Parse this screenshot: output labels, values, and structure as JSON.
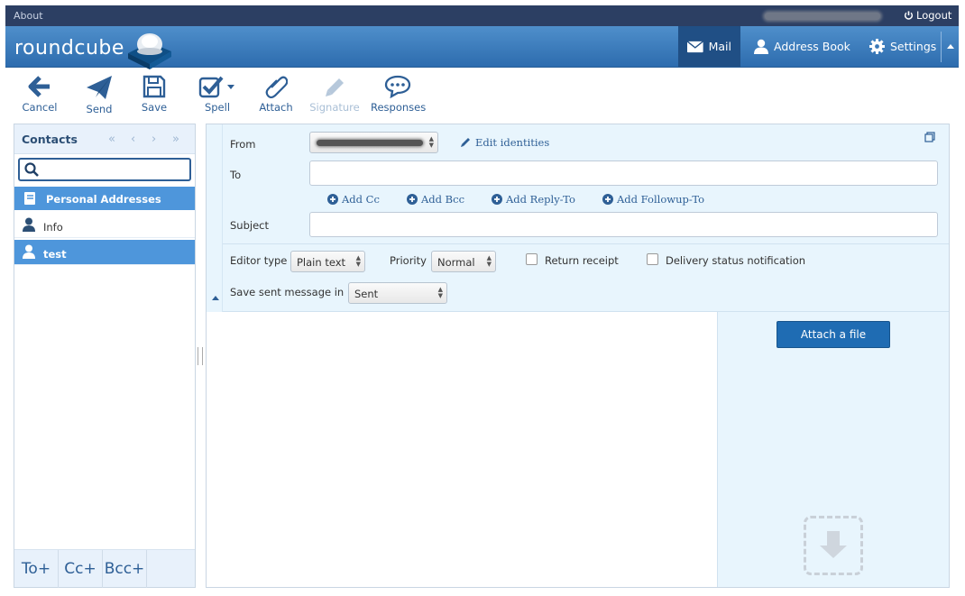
{
  "topline": {
    "about": "About",
    "logout": "Logout"
  },
  "header": {
    "logo": "roundcube",
    "tabs": [
      {
        "label": "Mail",
        "icon": "envelope-icon"
      },
      {
        "label": "Address Book",
        "icon": "person-icon"
      },
      {
        "label": "Settings",
        "icon": "gear-icon"
      }
    ]
  },
  "toolbar": {
    "cancel": "Cancel",
    "send": "Send",
    "save": "Save",
    "spell": "Spell",
    "attach": "Attach",
    "signature": "Signature",
    "responses": "Responses"
  },
  "contacts": {
    "title": "Contacts",
    "search_placeholder": "",
    "group": "Personal Addresses",
    "items": [
      {
        "name": "Info",
        "selected": false
      },
      {
        "name": "test",
        "selected": true
      }
    ],
    "footer": {
      "to": "To+",
      "cc": "Cc+",
      "bcc": "Bcc+"
    }
  },
  "compose": {
    "from_label": "From",
    "edit_identities": "Edit identities",
    "to_label": "To",
    "to_value": "",
    "add_cc": "Add Cc",
    "add_bcc": "Add Bcc",
    "add_reply_to": "Add Reply-To",
    "add_followup_to": "Add Followup-To",
    "subject_label": "Subject",
    "subject_value": "",
    "editor_type_label": "Editor type",
    "editor_type_value": "Plain text",
    "priority_label": "Priority",
    "priority_value": "Normal",
    "return_receipt": "Return receipt",
    "dsn": "Delivery status notification",
    "save_sent_label": "Save sent message in",
    "save_sent_value": "Sent",
    "attach_button": "Attach a file"
  },
  "colors": {
    "brand": "#2d6cae",
    "topbar": "#2c3f63",
    "selected": "#4e96db",
    "accent_text": "#2e5f96"
  }
}
